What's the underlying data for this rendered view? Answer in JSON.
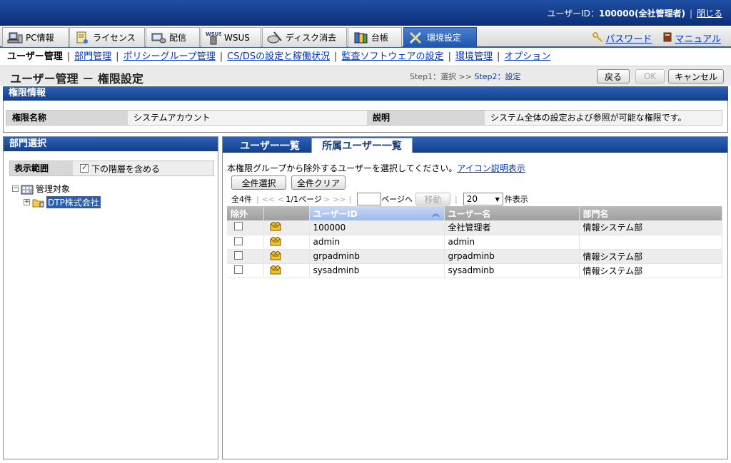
{
  "header": {
    "user_label": "ユーザーID：",
    "user_value": "100000(全社管理者)",
    "close_label": "閉じる"
  },
  "main_tabs": [
    {
      "label": "PC情報",
      "icon": "pc-icon"
    },
    {
      "label": "ライセンス",
      "icon": "license-icon"
    },
    {
      "label": "配信",
      "icon": "delivery-icon"
    },
    {
      "label": "WSUS",
      "icon": "wsus-icon"
    },
    {
      "label": "ディスク消去",
      "icon": "disk-erase-icon"
    },
    {
      "label": "台帳",
      "icon": "ledger-icon"
    },
    {
      "label": "環境設定",
      "icon": "settings-icon"
    }
  ],
  "util_links": {
    "password": "パスワード",
    "manual": "マニュアル"
  },
  "subnav": {
    "items": [
      "ユーザー管理",
      "部門管理",
      "ポリシーグループ管理",
      "CS/DSの設定と稼働状況",
      "監査ソフトウェアの設定",
      "環境管理",
      "オプション"
    ]
  },
  "title": {
    "text": "ユーザー管理 － 権限設定",
    "step1": "Step1：選択",
    "arrow": ">>",
    "step2": "Step2：設定"
  },
  "buttons": {
    "back": "戻る",
    "ok": "OK",
    "cancel": "キャンセル"
  },
  "perm_section": {
    "title": "権限情報",
    "name_label": "権限名称",
    "name_value": "システムアカウント",
    "desc_label": "説明",
    "desc_value": "システム全体の設定および参照が可能な権限です。"
  },
  "dept_section": {
    "title": "部門選択",
    "scope_label": "表示範囲",
    "include_sub_label": "下の階層を含める",
    "include_sub_checked": true,
    "tree": {
      "root": "管理対象",
      "child": "DTP株式会社"
    }
  },
  "right": {
    "tab_users": "ユーザー一覧",
    "tab_members": "所属ユーザー一覧",
    "instruction": "本権限グループから除外するユーザーを選択してください。",
    "icon_link": "アイコン説明表示",
    "select_all": "全件選択",
    "clear_all": "全件クリア",
    "pager": {
      "total": "全4件",
      "first": "<<",
      "prev": "<",
      "page": "1/1ページ",
      "next": ">",
      "last": ">>",
      "goto_suffix": "ページへ",
      "move": "移動",
      "per_page": "20",
      "per_page_suffix": "件表示"
    },
    "table": {
      "headers": [
        "除外",
        "",
        "ユーザーID",
        "ユーザー名",
        "部門名"
      ],
      "rows": [
        {
          "id": "100000",
          "name": "全社管理者",
          "dept": "情報システム部"
        },
        {
          "id": "admin",
          "name": "admin",
          "dept": ""
        },
        {
          "id": "grpadminb",
          "name": "grpadminb",
          "dept": "情報システム部"
        },
        {
          "id": "sysadminb",
          "name": "sysadminb",
          "dept": "情報システム部"
        }
      ]
    }
  },
  "colors": {
    "header_blue": "#0c2f78",
    "active_tab": "#1f57ad",
    "section_bar": "#123f8c"
  }
}
